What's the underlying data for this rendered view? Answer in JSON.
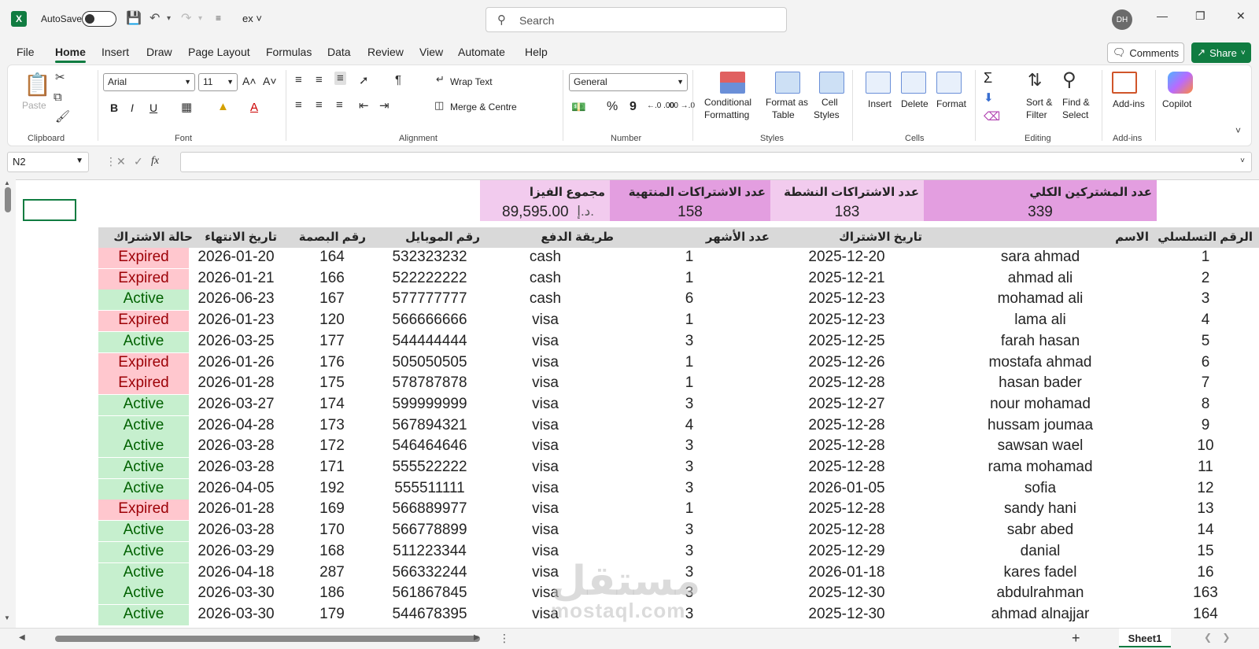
{
  "titlebar": {
    "logo": "X",
    "autosave_label": "AutoSave",
    "filename": "ex",
    "search_placeholder": "Search",
    "avatar": "DH"
  },
  "menu": {
    "tabs": [
      "File",
      "Home",
      "Insert",
      "Draw",
      "Page Layout",
      "Formulas",
      "Data",
      "Review",
      "View",
      "Automate",
      "Help"
    ],
    "active": "Home",
    "comments": "Comments",
    "share": "Share"
  },
  "ribbon": {
    "clipboard": {
      "paste": "Paste",
      "label": "Clipboard"
    },
    "font": {
      "name": "Arial",
      "size": "11",
      "label": "Font",
      "bold": "B",
      "italic": "I",
      "underline": "U",
      "grow": "A˄",
      "shrink": "A˅",
      "color": "A"
    },
    "alignment": {
      "wrap": "Wrap Text",
      "merge": "Merge & Centre",
      "label": "Alignment"
    },
    "number": {
      "format": "General",
      "label": "Number",
      "percent": "%",
      "comma": "9",
      "inc_dec": "←.0 .00",
      "dec_dec": ".00 →.0"
    },
    "styles": {
      "conditional": "Conditional",
      "conditional2": "Formatting",
      "format_as": "Format as",
      "format_as2": "Table",
      "cell": "Cell",
      "cell2": "Styles",
      "label": "Styles"
    },
    "cells": {
      "insert": "Insert",
      "delete": "Delete",
      "format": "Format",
      "label": "Cells"
    },
    "editing": {
      "sort": "Sort &",
      "sort2": "Filter",
      "find": "Find &",
      "find2": "Select",
      "label": "Editing",
      "sum": "Σ"
    },
    "addins": {
      "addins": "Add-ins",
      "label": "Add-ins"
    },
    "copilot": {
      "label": "Copilot"
    }
  },
  "formula_bar": {
    "name_box": "N2",
    "fx": "fx",
    "value": ""
  },
  "kpis": [
    {
      "header": "مجموع الفيزا",
      "value": "89,595.00",
      "currency": "د.إ.",
      "color": "#f2cbee"
    },
    {
      "header": "عدد الاشتراكات المنتهية",
      "value": "158",
      "color": "#e39ee0"
    },
    {
      "header": "عدد الاشتراكات النشطة",
      "value": "183",
      "color": "#f2cbee"
    },
    {
      "header": "عدد المشتركين الكلي",
      "value": "339",
      "color": "#e39ee0"
    }
  ],
  "table": {
    "headers": {
      "status": "حالة الاشتراك",
      "end_date": "تاريخ الانتهاء",
      "fingerprint": "رقم البصمة",
      "mobile": "رقم الموبايل",
      "payment": "طريقة الدفع",
      "months": "عدد الأشهر",
      "start_date": "تاريخ الاشتراك",
      "name": "الاسم",
      "serial": "الرقم التسلسلي"
    },
    "rows": [
      {
        "status": "Expired",
        "end": "2026-01-20",
        "fp": "164",
        "mobile": "532323232",
        "pay": "cash",
        "months": "1",
        "start": "2025-12-20",
        "name": "sara ahmad",
        "serial": "1"
      },
      {
        "status": "Expired",
        "end": "2026-01-21",
        "fp": "166",
        "mobile": "522222222",
        "pay": "cash",
        "months": "1",
        "start": "2025-12-21",
        "name": "ahmad ali",
        "serial": "2"
      },
      {
        "status": "Active",
        "end": "2026-06-23",
        "fp": "167",
        "mobile": "577777777",
        "pay": "cash",
        "months": "6",
        "start": "2025-12-23",
        "name": "mohamad ali",
        "serial": "3"
      },
      {
        "status": "Expired",
        "end": "2026-01-23",
        "fp": "120",
        "mobile": "566666666",
        "pay": "visa",
        "months": "1",
        "start": "2025-12-23",
        "name": "lama ali",
        "serial": "4"
      },
      {
        "status": "Active",
        "end": "2026-03-25",
        "fp": "177",
        "mobile": "544444444",
        "pay": "visa",
        "months": "3",
        "start": "2025-12-25",
        "name": "farah hasan",
        "serial": "5"
      },
      {
        "status": "Expired",
        "end": "2026-01-26",
        "fp": "176",
        "mobile": "505050505",
        "pay": "visa",
        "months": "1",
        "start": "2025-12-26",
        "name": "mostafa ahmad",
        "serial": "6"
      },
      {
        "status": "Expired",
        "end": "2026-01-28",
        "fp": "175",
        "mobile": "578787878",
        "pay": "visa",
        "months": "1",
        "start": "2025-12-28",
        "name": "hasan bader",
        "serial": "7"
      },
      {
        "status": "Active",
        "end": "2026-03-27",
        "fp": "174",
        "mobile": "599999999",
        "pay": "visa",
        "months": "3",
        "start": "2025-12-27",
        "name": "nour mohamad",
        "serial": "8"
      },
      {
        "status": "Active",
        "end": "2026-04-28",
        "fp": "173",
        "mobile": "567894321",
        "pay": "visa",
        "months": "4",
        "start": "2025-12-28",
        "name": "hussam joumaa",
        "serial": "9"
      },
      {
        "status": "Active",
        "end": "2026-03-28",
        "fp": "172",
        "mobile": "546464646",
        "pay": "visa",
        "months": "3",
        "start": "2025-12-28",
        "name": "sawsan wael",
        "serial": "10"
      },
      {
        "status": "Active",
        "end": "2026-03-28",
        "fp": "171",
        "mobile": "555522222",
        "pay": "visa",
        "months": "3",
        "start": "2025-12-28",
        "name": "rama mohamad",
        "serial": "11"
      },
      {
        "status": "Active",
        "end": "2026-04-05",
        "fp": "192",
        "mobile": "555511111",
        "pay": "visa",
        "months": "3",
        "start": "2026-01-05",
        "name": "sofia",
        "serial": "12"
      },
      {
        "status": "Expired",
        "end": "2026-01-28",
        "fp": "169",
        "mobile": "566889977",
        "pay": "visa",
        "months": "1",
        "start": "2025-12-28",
        "name": "sandy hani",
        "serial": "13"
      },
      {
        "status": "Active",
        "end": "2026-03-28",
        "fp": "170",
        "mobile": "566778899",
        "pay": "visa",
        "months": "3",
        "start": "2025-12-28",
        "name": "sabr abed",
        "serial": "14"
      },
      {
        "status": "Active",
        "end": "2026-03-29",
        "fp": "168",
        "mobile": "511223344",
        "pay": "visa",
        "months": "3",
        "start": "2025-12-29",
        "name": "danial",
        "serial": "15"
      },
      {
        "status": "Active",
        "end": "2026-04-18",
        "fp": "287",
        "mobile": "566332244",
        "pay": "visa",
        "months": "3",
        "start": "2026-01-18",
        "name": "kares fadel",
        "serial": "16"
      },
      {
        "status": "Active",
        "end": "2026-03-30",
        "fp": "186",
        "mobile": "561867845",
        "pay": "visa",
        "months": "3",
        "start": "2025-12-30",
        "name": "abdulrahman",
        "serial": "163"
      },
      {
        "status": "Active",
        "end": "2026-03-30",
        "fp": "179",
        "mobile": "544678395",
        "pay": "visa",
        "months": "3",
        "start": "2025-12-30",
        "name": "ahmad alnajjar",
        "serial": "164"
      }
    ]
  },
  "watermark": {
    "arabic": "مستقل",
    "latin": "mostaql.com"
  },
  "sheet_tabs": {
    "active": "Sheet1",
    "add": "+"
  },
  "colors": {
    "accent": "#107c41",
    "expired_bg": "#ffc7ce",
    "expired_fg": "#9c0006",
    "active_bg": "#c6efce",
    "active_fg": "#006100",
    "header_bg": "#d9d9d9"
  }
}
